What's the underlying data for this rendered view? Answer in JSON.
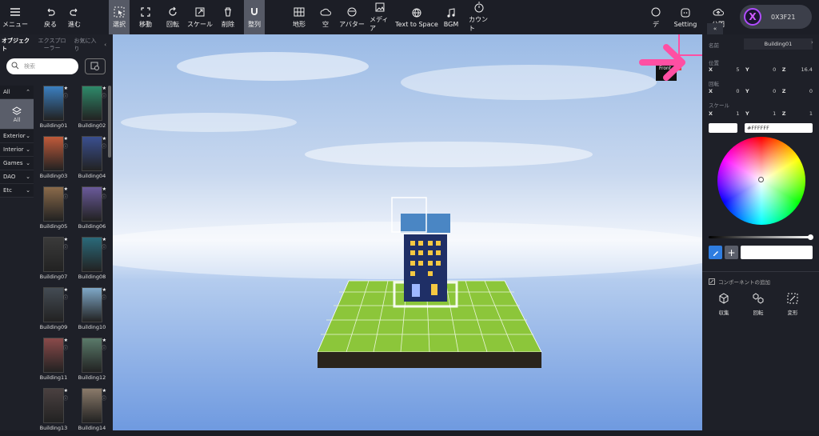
{
  "toolbar": {
    "menu": "メニュー",
    "back": "戻る",
    "forward": "進む",
    "select": "選択",
    "move": "移動",
    "rotate": "回転",
    "scale": "スケール",
    "delete": "削除",
    "align": "整列",
    "terrain": "地形",
    "sky": "空",
    "avatar": "アバター",
    "media": "メディア",
    "text_to_space": "Text to Space",
    "bgm": "BGM",
    "count": "カウント",
    "design": "デ",
    "setting": "Setting",
    "publish": "公開"
  },
  "wallet": {
    "address": "0X3F21",
    "avatar_letter": "X"
  },
  "left": {
    "tabs": [
      "オブジェクト",
      "エクスプローラー",
      "お気に入り"
    ],
    "search_placeholder": "検索",
    "categories": [
      "All",
      "All",
      "Exterior",
      "Interior",
      "Games",
      "DAO",
      "Etc"
    ],
    "items": [
      "Building01",
      "Building02",
      "Building03",
      "Building04",
      "Building05",
      "Building06",
      "Building07",
      "Building08",
      "Building09",
      "Building10",
      "Building11",
      "Building12",
      "Building13",
      "Building14"
    ]
  },
  "viewport": {
    "front_label": "Front"
  },
  "right": {
    "name_label": "名前",
    "name_value": "Building01",
    "position_label": "位置",
    "position": {
      "x": "5",
      "y": "0",
      "z": "16.4"
    },
    "rotation_label": "回転",
    "rotation": {
      "x": "0",
      "y": "0",
      "z": "0"
    },
    "scale_label": "スケール",
    "scale": {
      "x": "1",
      "y": "1",
      "z": "1"
    },
    "color_hex": "#FFFFFF",
    "add_component": "コンポーネントの追加",
    "components": [
      "収集",
      "回転",
      "変形"
    ]
  },
  "colors": {
    "accent_pink": "#ff4fa3",
    "panel": "#1e2028",
    "topbar": "#1c1e26"
  }
}
